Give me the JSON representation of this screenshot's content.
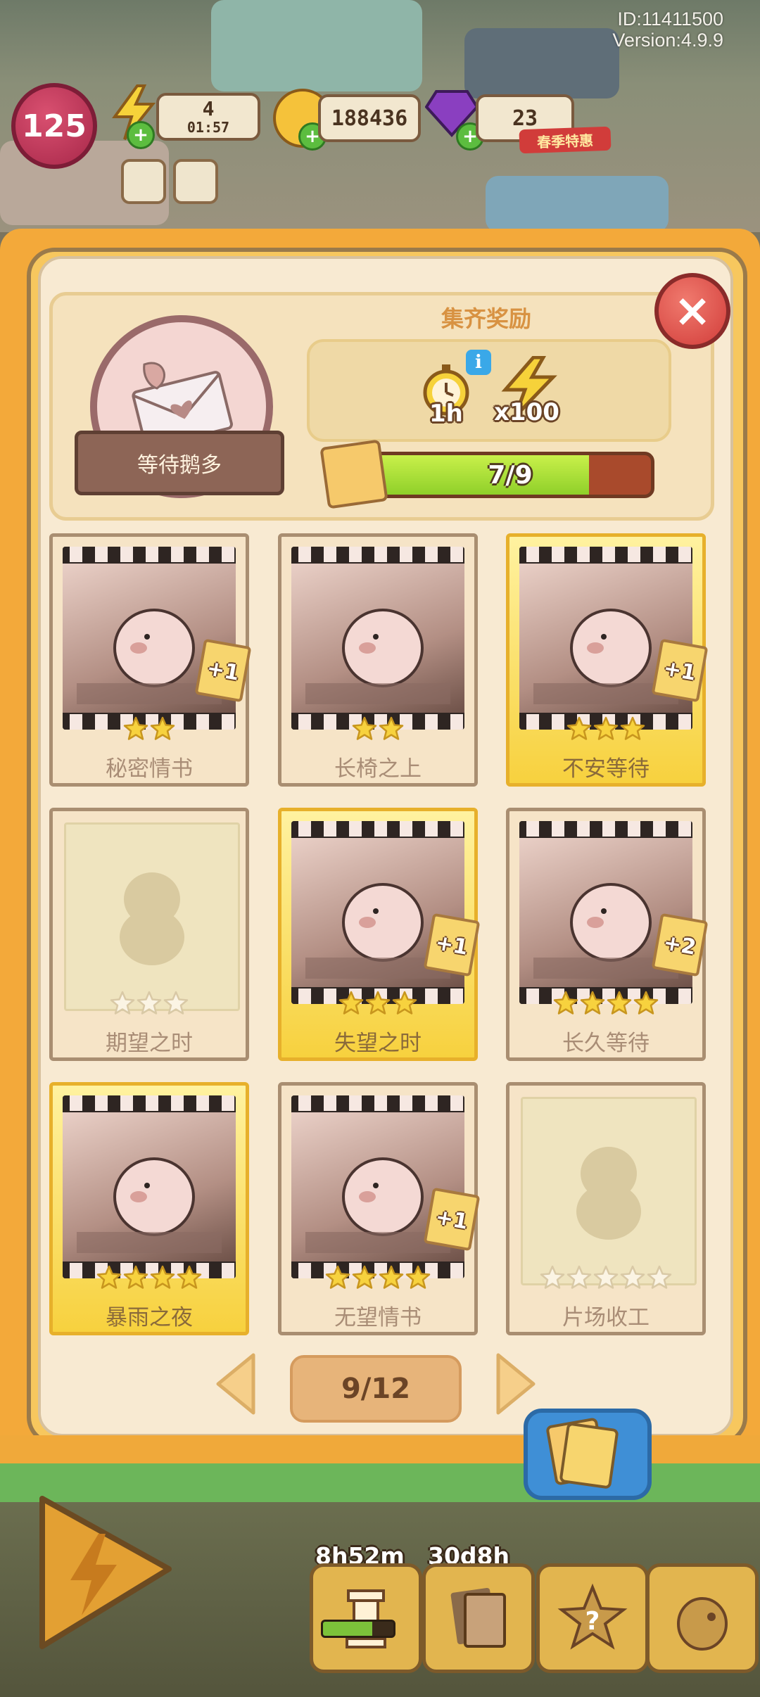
{
  "status": {
    "id_text": "ID:11411500",
    "version_text": "Version:4.9.9"
  },
  "hud": {
    "level": "125",
    "energy": "4",
    "energy_timer": "01:57",
    "coins": "188436",
    "gems": "23",
    "season_label": "春季特惠"
  },
  "album": {
    "name": "等待鹅多",
    "reward_title": "集齐奖励",
    "reward_time": "1h",
    "reward_energy": "x100",
    "progress_text": "7/9",
    "progress_fraction": 0.78
  },
  "cards": [
    {
      "title": "秘密情书",
      "stars_total": 2,
      "stars_filled": 2,
      "collected": true,
      "gold": false,
      "plus": "+1"
    },
    {
      "title": "长椅之上",
      "stars_total": 2,
      "stars_filled": 2,
      "collected": true,
      "gold": false,
      "plus": ""
    },
    {
      "title": "不安等待",
      "stars_total": 3,
      "stars_filled": 3,
      "collected": true,
      "gold": true,
      "plus": "+1"
    },
    {
      "title": "期望之时",
      "stars_total": 3,
      "stars_filled": 0,
      "collected": false,
      "gold": false,
      "plus": ""
    },
    {
      "title": "失望之时",
      "stars_total": 3,
      "stars_filled": 3,
      "collected": true,
      "gold": true,
      "plus": "+1"
    },
    {
      "title": "长久等待",
      "stars_total": 4,
      "stars_filled": 4,
      "collected": true,
      "gold": false,
      "plus": "+2"
    },
    {
      "title": "暴雨之夜",
      "stars_total": 4,
      "stars_filled": 4,
      "collected": true,
      "gold": true,
      "plus": ""
    },
    {
      "title": "无望情书",
      "stars_total": 4,
      "stars_filled": 4,
      "collected": true,
      "gold": false,
      "plus": "+1"
    },
    {
      "title": "片场收工",
      "stars_total": 5,
      "stars_filled": 0,
      "collected": false,
      "gold": false,
      "plus": ""
    }
  ],
  "pager": {
    "page_text": "9/12"
  },
  "bottom": {
    "timer_left": "8h52m",
    "timer_right": "30d8h"
  },
  "colors": {
    "panel": "#f8ead2",
    "frame": "#f3a93a",
    "progress_fill": "#a9e23a",
    "progress_track": "#a94a2c",
    "close": "#d23d3a",
    "star": "#f7d23e"
  },
  "icons": {
    "close": "close-icon",
    "timer": "alarm-clock-icon",
    "energy": "lightning-icon",
    "prev": "arrow-left-icon",
    "next": "arrow-right-icon",
    "info": "info-icon",
    "collection": "card-pack-icon"
  }
}
